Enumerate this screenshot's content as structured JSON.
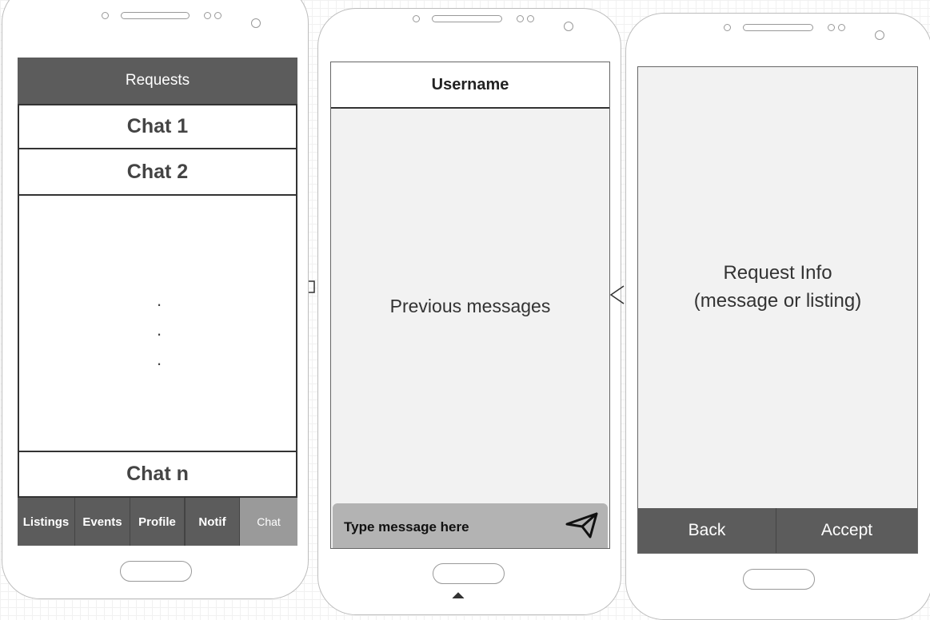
{
  "screen1": {
    "header": "Requests",
    "chats": [
      "Chat 1",
      "Chat 2"
    ],
    "ellipsis": [
      ".",
      ".",
      "."
    ],
    "last_chat": "Chat n",
    "tabs": [
      "Listings",
      "Events",
      "Profile",
      "Notif",
      "Chat"
    ],
    "active_tab": "Chat"
  },
  "screen2": {
    "header": "Username",
    "body": "Previous messages",
    "input_placeholder": "Type message here",
    "send_icon": "send-icon"
  },
  "screen3": {
    "body_line1": "Request Info",
    "body_line2": "(message or listing)",
    "back_label": "Back",
    "accept_label": "Accept"
  },
  "colors": {
    "header_dark": "#5c5c5c",
    "tab_active": "#9a9a9a",
    "screen_bg": "#f2f2f2",
    "input_bg": "#b3b3b3"
  }
}
